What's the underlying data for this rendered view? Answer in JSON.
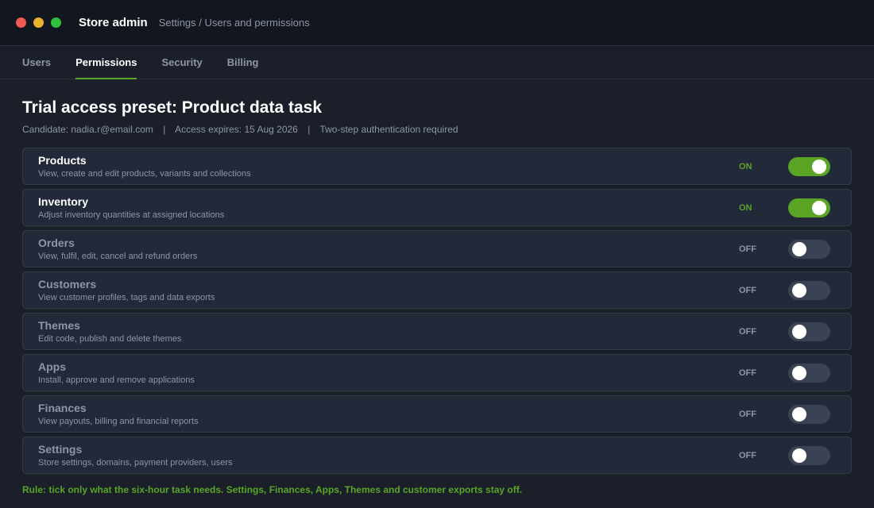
{
  "window": {
    "app_title": "Store admin",
    "breadcrumb": "Settings / Users and permissions"
  },
  "tabs": [
    {
      "label": "Users",
      "active": false
    },
    {
      "label": "Permissions",
      "active": true
    },
    {
      "label": "Security",
      "active": false
    },
    {
      "label": "Billing",
      "active": false
    }
  ],
  "page": {
    "title": "Trial access preset: Product data task",
    "candidate": "Candidate: nadia.r@email.com",
    "expires": "Access expires: 15 Aug 2026",
    "auth": "Two-step authentication required",
    "separator": "|"
  },
  "permissions": [
    {
      "name": "Products",
      "description": "View, create and edit products, variants and collections",
      "state": "ON",
      "enabled": true
    },
    {
      "name": "Inventory",
      "description": "Adjust inventory quantities at assigned locations",
      "state": "ON",
      "enabled": true
    },
    {
      "name": "Orders",
      "description": "View, fulfil, edit, cancel and refund orders",
      "state": "OFF",
      "enabled": false
    },
    {
      "name": "Customers",
      "description": "View customer profiles, tags and data exports",
      "state": "OFF",
      "enabled": false
    },
    {
      "name": "Themes",
      "description": "Edit code, publish and delete themes",
      "state": "OFF",
      "enabled": false
    },
    {
      "name": "Apps",
      "description": "Install, approve and remove applications",
      "state": "OFF",
      "enabled": false
    },
    {
      "name": "Finances",
      "description": "View payouts, billing and financial reports",
      "state": "OFF",
      "enabled": false
    },
    {
      "name": "Settings",
      "description": "Store settings, domains, payment providers, users",
      "state": "OFF",
      "enabled": false
    }
  ],
  "rule": "Rule: tick only what the six-hour task needs. Settings, Finances, Apps, Themes and customer exports stay off.",
  "colors": {
    "accent": "#5aa526",
    "background": "#1a1f2a",
    "titlebar": "#12161e",
    "row": "#222938",
    "toggle_off": "#3a4254"
  }
}
